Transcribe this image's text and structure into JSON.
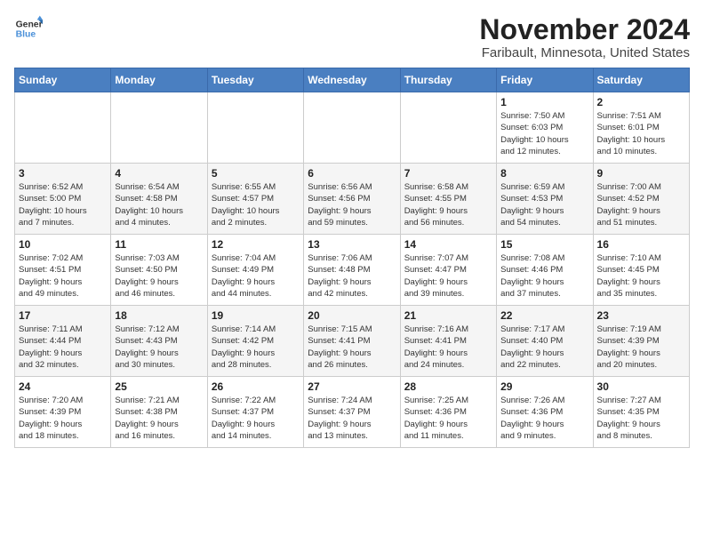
{
  "header": {
    "logo_line1": "General",
    "logo_line2": "Blue",
    "month": "November 2024",
    "location": "Faribault, Minnesota, United States"
  },
  "weekdays": [
    "Sunday",
    "Monday",
    "Tuesday",
    "Wednesday",
    "Thursday",
    "Friday",
    "Saturday"
  ],
  "weeks": [
    [
      {
        "day": "",
        "info": ""
      },
      {
        "day": "",
        "info": ""
      },
      {
        "day": "",
        "info": ""
      },
      {
        "day": "",
        "info": ""
      },
      {
        "day": "",
        "info": ""
      },
      {
        "day": "1",
        "info": "Sunrise: 7:50 AM\nSunset: 6:03 PM\nDaylight: 10 hours\nand 12 minutes."
      },
      {
        "day": "2",
        "info": "Sunrise: 7:51 AM\nSunset: 6:01 PM\nDaylight: 10 hours\nand 10 minutes."
      }
    ],
    [
      {
        "day": "3",
        "info": "Sunrise: 6:52 AM\nSunset: 5:00 PM\nDaylight: 10 hours\nand 7 minutes."
      },
      {
        "day": "4",
        "info": "Sunrise: 6:54 AM\nSunset: 4:58 PM\nDaylight: 10 hours\nand 4 minutes."
      },
      {
        "day": "5",
        "info": "Sunrise: 6:55 AM\nSunset: 4:57 PM\nDaylight: 10 hours\nand 2 minutes."
      },
      {
        "day": "6",
        "info": "Sunrise: 6:56 AM\nSunset: 4:56 PM\nDaylight: 9 hours\nand 59 minutes."
      },
      {
        "day": "7",
        "info": "Sunrise: 6:58 AM\nSunset: 4:55 PM\nDaylight: 9 hours\nand 56 minutes."
      },
      {
        "day": "8",
        "info": "Sunrise: 6:59 AM\nSunset: 4:53 PM\nDaylight: 9 hours\nand 54 minutes."
      },
      {
        "day": "9",
        "info": "Sunrise: 7:00 AM\nSunset: 4:52 PM\nDaylight: 9 hours\nand 51 minutes."
      }
    ],
    [
      {
        "day": "10",
        "info": "Sunrise: 7:02 AM\nSunset: 4:51 PM\nDaylight: 9 hours\nand 49 minutes."
      },
      {
        "day": "11",
        "info": "Sunrise: 7:03 AM\nSunset: 4:50 PM\nDaylight: 9 hours\nand 46 minutes."
      },
      {
        "day": "12",
        "info": "Sunrise: 7:04 AM\nSunset: 4:49 PM\nDaylight: 9 hours\nand 44 minutes."
      },
      {
        "day": "13",
        "info": "Sunrise: 7:06 AM\nSunset: 4:48 PM\nDaylight: 9 hours\nand 42 minutes."
      },
      {
        "day": "14",
        "info": "Sunrise: 7:07 AM\nSunset: 4:47 PM\nDaylight: 9 hours\nand 39 minutes."
      },
      {
        "day": "15",
        "info": "Sunrise: 7:08 AM\nSunset: 4:46 PM\nDaylight: 9 hours\nand 37 minutes."
      },
      {
        "day": "16",
        "info": "Sunrise: 7:10 AM\nSunset: 4:45 PM\nDaylight: 9 hours\nand 35 minutes."
      }
    ],
    [
      {
        "day": "17",
        "info": "Sunrise: 7:11 AM\nSunset: 4:44 PM\nDaylight: 9 hours\nand 32 minutes."
      },
      {
        "day": "18",
        "info": "Sunrise: 7:12 AM\nSunset: 4:43 PM\nDaylight: 9 hours\nand 30 minutes."
      },
      {
        "day": "19",
        "info": "Sunrise: 7:14 AM\nSunset: 4:42 PM\nDaylight: 9 hours\nand 28 minutes."
      },
      {
        "day": "20",
        "info": "Sunrise: 7:15 AM\nSunset: 4:41 PM\nDaylight: 9 hours\nand 26 minutes."
      },
      {
        "day": "21",
        "info": "Sunrise: 7:16 AM\nSunset: 4:41 PM\nDaylight: 9 hours\nand 24 minutes."
      },
      {
        "day": "22",
        "info": "Sunrise: 7:17 AM\nSunset: 4:40 PM\nDaylight: 9 hours\nand 22 minutes."
      },
      {
        "day": "23",
        "info": "Sunrise: 7:19 AM\nSunset: 4:39 PM\nDaylight: 9 hours\nand 20 minutes."
      }
    ],
    [
      {
        "day": "24",
        "info": "Sunrise: 7:20 AM\nSunset: 4:39 PM\nDaylight: 9 hours\nand 18 minutes."
      },
      {
        "day": "25",
        "info": "Sunrise: 7:21 AM\nSunset: 4:38 PM\nDaylight: 9 hours\nand 16 minutes."
      },
      {
        "day": "26",
        "info": "Sunrise: 7:22 AM\nSunset: 4:37 PM\nDaylight: 9 hours\nand 14 minutes."
      },
      {
        "day": "27",
        "info": "Sunrise: 7:24 AM\nSunset: 4:37 PM\nDaylight: 9 hours\nand 13 minutes."
      },
      {
        "day": "28",
        "info": "Sunrise: 7:25 AM\nSunset: 4:36 PM\nDaylight: 9 hours\nand 11 minutes."
      },
      {
        "day": "29",
        "info": "Sunrise: 7:26 AM\nSunset: 4:36 PM\nDaylight: 9 hours\nand 9 minutes."
      },
      {
        "day": "30",
        "info": "Sunrise: 7:27 AM\nSunset: 4:35 PM\nDaylight: 9 hours\nand 8 minutes."
      }
    ]
  ]
}
